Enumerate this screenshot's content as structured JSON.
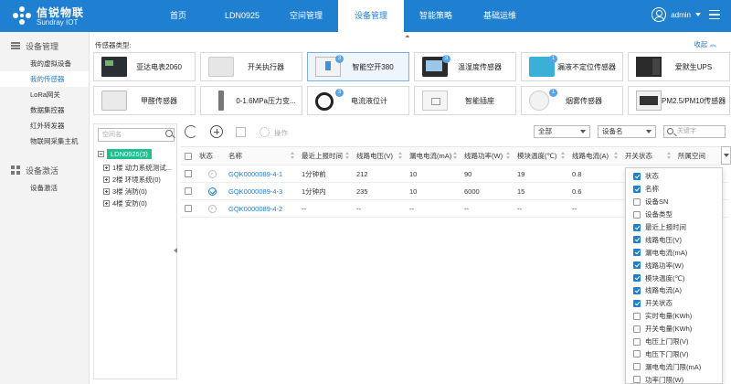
{
  "brand": {
    "name_cn": "信锐物联",
    "name_en": "Sundray IOT"
  },
  "nav": [
    {
      "label": "首页",
      "active": false
    },
    {
      "label": "LDN0925",
      "active": false
    },
    {
      "label": "空间管理",
      "active": false
    },
    {
      "label": "设备管理",
      "active": true
    },
    {
      "label": "智能策略",
      "active": false
    },
    {
      "label": "基础运维",
      "active": false
    }
  ],
  "user": {
    "name": "admin"
  },
  "sidebar": {
    "group1": "设备管理",
    "items1": [
      "我的虚拟设备",
      "我的传感器",
      "LoRa网关",
      "数据集控器",
      "红外转发器",
      "物联网采集主机"
    ],
    "group2": "设备激活",
    "items2": [
      "设备激活"
    ]
  },
  "sensor_types": {
    "title": "传感器类型:",
    "fold_label": "收起 ︽",
    "items": [
      {
        "label": "亚达电表2060",
        "badge": "",
        "icon": "meter-icon",
        "selected": false
      },
      {
        "label": "开关执行器",
        "badge": "",
        "icon": "switch-actuator-icon",
        "selected": false
      },
      {
        "label": "智能空开380",
        "badge": "3",
        "icon": "breaker-icon",
        "selected": true
      },
      {
        "label": "温湿度传感器",
        "badge": "3",
        "icon": "thermo-hygro-icon",
        "selected": false
      },
      {
        "label": "漏液不定位传感器",
        "badge": "1",
        "icon": "leak-sensor-icon",
        "selected": false
      },
      {
        "label": "爱默生UPS",
        "badge": "",
        "icon": "ups-icon",
        "selected": false
      },
      {
        "label": "甲醛传感器",
        "badge": "",
        "icon": "formaldehyde-icon",
        "selected": false
      },
      {
        "label": "0-1.6MPa压力变...",
        "badge": "",
        "icon": "pressure-icon",
        "selected": false
      },
      {
        "label": "电流液位计",
        "badge": "3",
        "icon": "level-meter-icon",
        "selected": false
      },
      {
        "label": "智能插座",
        "badge": "",
        "icon": "socket-icon",
        "selected": false
      },
      {
        "label": "烟雾传感器",
        "badge": "1",
        "icon": "smoke-icon",
        "selected": false
      },
      {
        "label": "PM2.5/PM10传感器",
        "badge": "",
        "icon": "pm-sensor-icon",
        "selected": false
      }
    ]
  },
  "tree": {
    "search_placeholder": "空间名",
    "root": "LDN0925(3)",
    "nodes": [
      "1楼 动力系统测试...",
      "2楼 环境系统(0)",
      "3楼 消防(0)",
      "4楼 安防(0)"
    ]
  },
  "toolbar": {
    "operation_label": "操作",
    "filter_all": "全部",
    "filter_field": "设备名",
    "keyword_placeholder": "关键字"
  },
  "table": {
    "columns": [
      "状态",
      "名称",
      "最近上报时间",
      "线路电压(V)",
      "漏电电流(mA)",
      "线路功率(W)",
      "模块温度(℃)",
      "线路电流(A)",
      "开关状态",
      "所属空间"
    ],
    "rows": [
      {
        "status": "offline",
        "name": "GQK0000089-4-1",
        "time": "1分钟前",
        "voltage": "212",
        "leak": "10",
        "power": "90",
        "temp": "19",
        "current": "0.8",
        "switch": "",
        "space": ""
      },
      {
        "status": "online",
        "name": "GQK0000089-4-3",
        "time": "1分钟内",
        "voltage": "235",
        "leak": "10",
        "power": "6000",
        "temp": "15",
        "current": "0.6",
        "switch": "",
        "space": ""
      },
      {
        "status": "unknown",
        "name": "GQK0000089-4-2",
        "time": "--",
        "voltage": "--",
        "leak": "--",
        "power": "--",
        "temp": "--",
        "current": "--",
        "switch": "",
        "space": ""
      }
    ]
  },
  "column_menu": [
    {
      "label": "状态",
      "checked": true
    },
    {
      "label": "名称",
      "checked": true
    },
    {
      "label": "设备SN",
      "checked": false
    },
    {
      "label": "设备类型",
      "checked": false
    },
    {
      "label": "最近上报时间",
      "checked": true
    },
    {
      "label": "线路电压(V)",
      "checked": true
    },
    {
      "label": "漏电电流(mA)",
      "checked": true
    },
    {
      "label": "线路功率(W)",
      "checked": true
    },
    {
      "label": "模块温度(℃)",
      "checked": true
    },
    {
      "label": "线路电流(A)",
      "checked": true
    },
    {
      "label": "开关状态",
      "checked": true
    },
    {
      "label": "实时电量(KWh)",
      "checked": false
    },
    {
      "label": "开关电量(KWh)",
      "checked": false
    },
    {
      "label": "电压上门限(V)",
      "checked": false
    },
    {
      "label": "电压下门限(V)",
      "checked": false
    },
    {
      "label": "漏电电流门限(mA)",
      "checked": false
    },
    {
      "label": "功率门限(W)",
      "checked": false
    }
  ],
  "colors": {
    "primary": "#1f7fd1",
    "tree_root": "#1fbf8f"
  }
}
